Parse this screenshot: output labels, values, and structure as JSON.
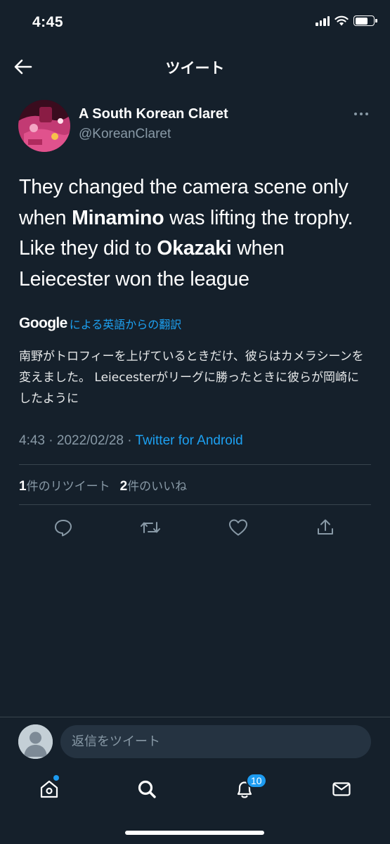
{
  "status_bar": {
    "time": "4:45"
  },
  "header": {
    "back_icon": "arrow-left-icon",
    "title": "ツイート"
  },
  "tweet": {
    "author_name": "A South Korean Claret",
    "author_handle": "@KoreanClaret",
    "text_parts": [
      "They changed the camera scene only when ",
      "Minamino",
      " was lifting the trophy. Like they did to ",
      "Okazaki",
      " when Leiecester won the league"
    ],
    "translate_brand": "Google",
    "translate_label": "による英語からの翻訳",
    "translation": "南野がトロフィーを上げているときだけ、彼らはカメラシーンを変えました。 Leiecesterがリーグに勝ったときに彼らが岡崎にしたように",
    "time": "4:43",
    "date": "2022/02/28",
    "client": "Twitter for Android",
    "separator": " · ",
    "retweet_count": "1",
    "retweet_label": "件のリツイート",
    "like_count": "2",
    "like_label": "件のいいね"
  },
  "actions": {
    "reply_icon": "reply-bubble-icon",
    "retweet_icon": "retweet-icon",
    "like_icon": "heart-icon",
    "share_icon": "share-icon"
  },
  "reply_bar": {
    "placeholder": "返信をツイート"
  },
  "tab_bar": {
    "notification_count": "10",
    "items": [
      "home-icon",
      "search-icon",
      "bell-icon",
      "mail-icon"
    ]
  },
  "colors": {
    "background": "#15202b",
    "accent": "#1da1f2",
    "muted_text": "#8899a6",
    "divider": "#38444d"
  }
}
